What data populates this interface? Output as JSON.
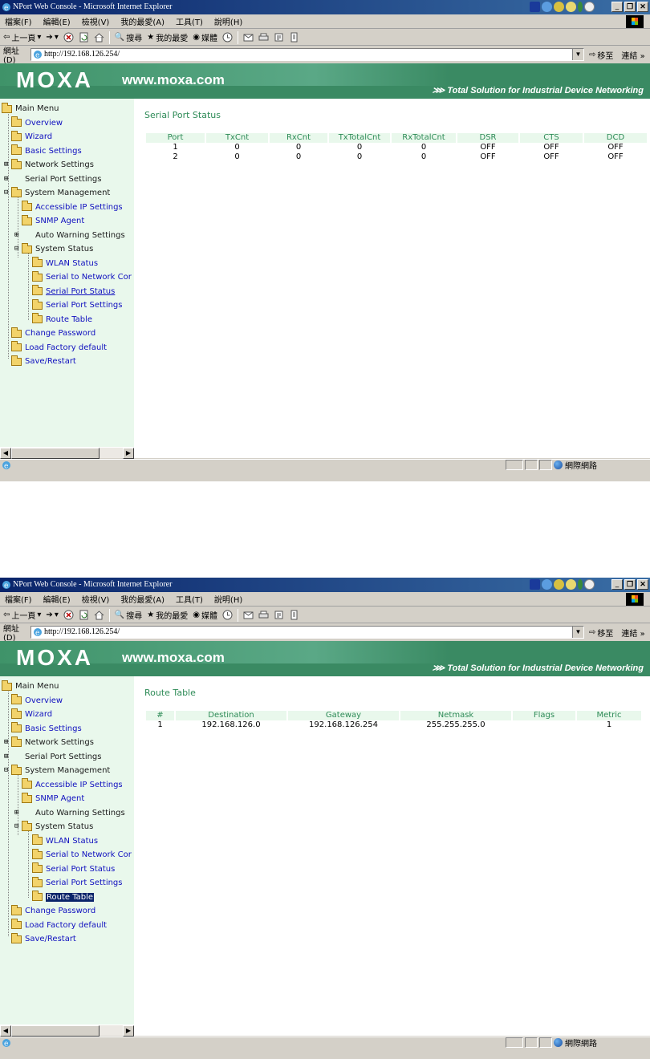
{
  "browser": {
    "title": "NPort Web Console - Microsoft Internet Explorer",
    "menu": [
      "檔案(F)",
      "編輯(E)",
      "檢視(V)",
      "我的最愛(A)",
      "工具(T)",
      "說明(H)"
    ],
    "toolbar": {
      "back_label": "上一頁",
      "search_label": "搜尋",
      "favorites_label": "我的最愛",
      "media_label": "媒體"
    },
    "address_label": "網址(D)",
    "address_value": "http://192.168.126.254/",
    "go_label": "移至",
    "links_label": "連結 »",
    "zone_label": "網際網路",
    "window_buttons": {
      "minimize": "_",
      "restore": "❐",
      "close": "✕"
    }
  },
  "banner": {
    "logo": "MOXA",
    "url": "www.moxa.com",
    "tagline": "Total Solution for Industrial Device Networking"
  },
  "sidebar": {
    "items": {
      "main_menu": "Main Menu",
      "overview": "Overview",
      "wizard": "Wizard",
      "basic_settings": "Basic Settings",
      "network_settings": "Network Settings",
      "serial_port_settings": "Serial Port Settings",
      "system_management": "System Management",
      "accessible_ip_settings": "Accessible IP Settings",
      "snmp_agent": "SNMP Agent",
      "auto_warning_settings": "Auto Warning Settings",
      "system_status": "System Status",
      "wlan_status": "WLAN Status",
      "serial_to_network": "Serial to Network Cor",
      "serial_port_status": "Serial Port Status",
      "sub_serial_port_settings": "Serial Port Settings",
      "route_table": "Route Table",
      "change_password": "Change Password",
      "load_factory_default": "Load Factory default",
      "save_restart": "Save/Restart"
    }
  },
  "screens": {
    "serial_port_status": {
      "title": "Serial Port Status",
      "columns": [
        "Port",
        "TxCnt",
        "RxCnt",
        "TxTotalCnt",
        "RxTotalCnt",
        "DSR",
        "CTS",
        "DCD"
      ],
      "rows": [
        [
          "1",
          "0",
          "0",
          "0",
          "0",
          "OFF",
          "OFF",
          "OFF"
        ],
        [
          "2",
          "0",
          "0",
          "0",
          "0",
          "OFF",
          "OFF",
          "OFF"
        ]
      ]
    },
    "route_table": {
      "title": "Route Table",
      "columns": [
        "#",
        "Destination",
        "Gateway",
        "Netmask",
        "Flags",
        "Metric"
      ],
      "rows": [
        [
          "1",
          "192.168.126.0",
          "192.168.126.254",
          "255.255.255.0",
          "",
          "1"
        ]
      ]
    }
  },
  "colors": {
    "accent_green": "#2e8b57",
    "banner_green": "#3a8a63",
    "sidebar_bg": "#e9f8ec",
    "selection": "#0a246a"
  }
}
